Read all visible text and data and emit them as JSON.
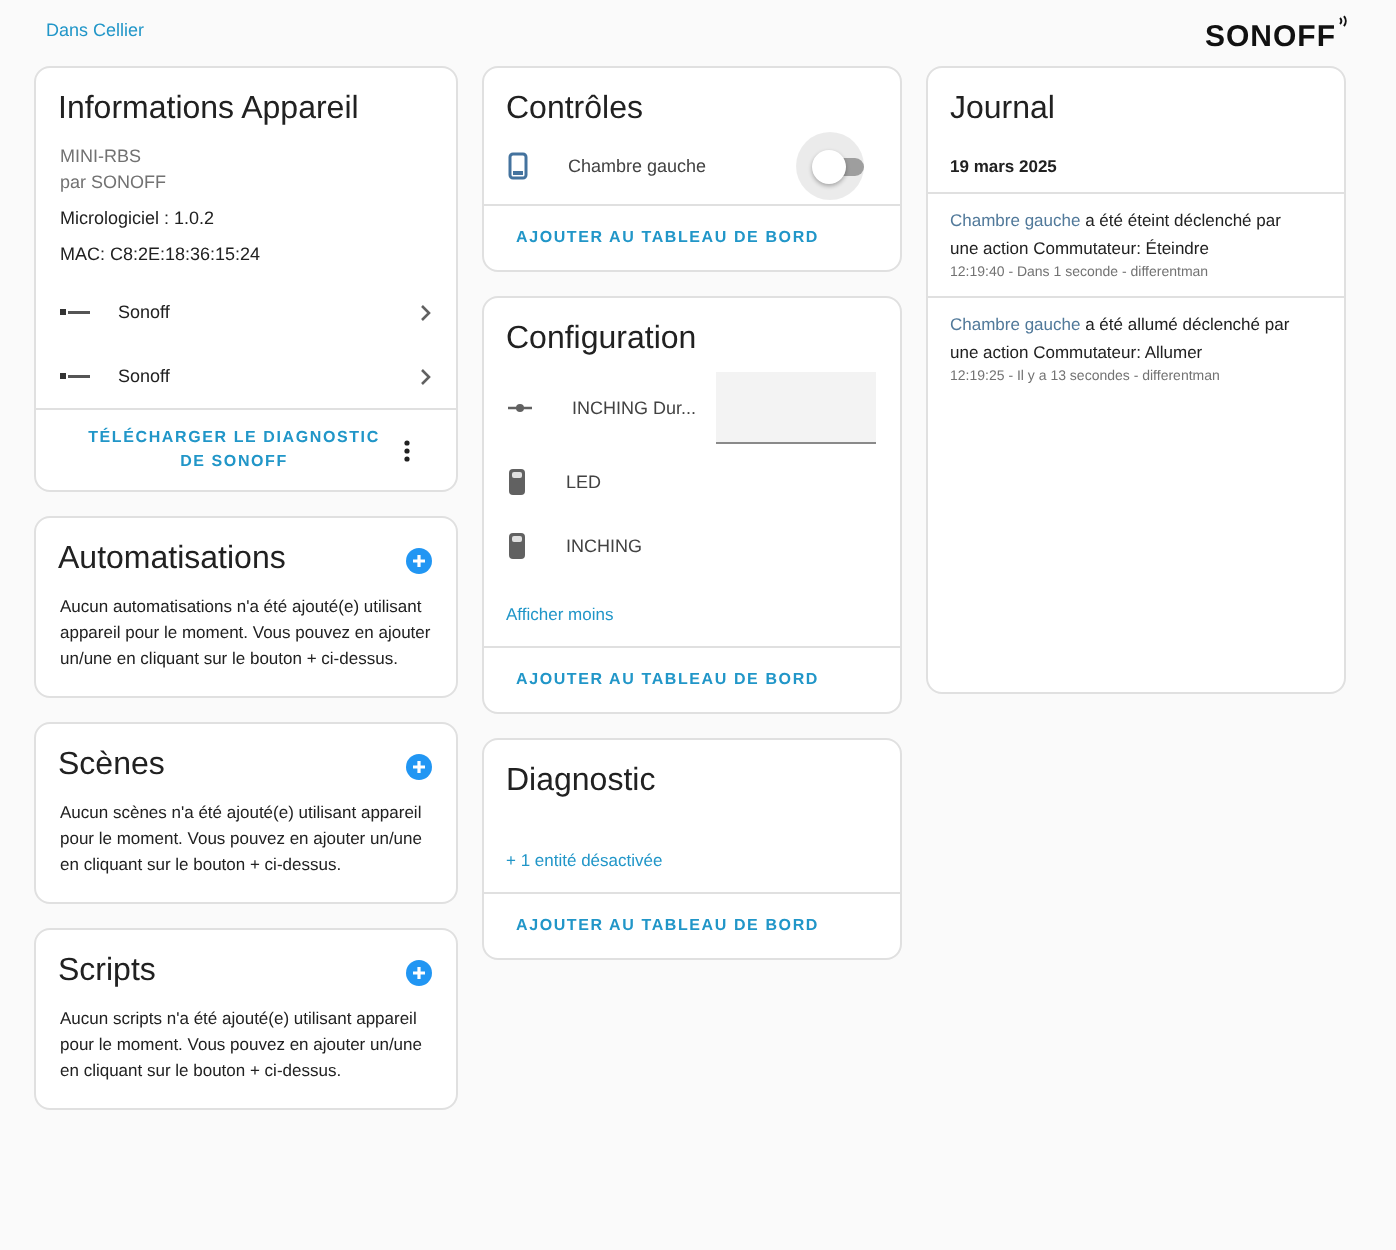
{
  "breadcrumb": "Dans Cellier",
  "logo": "SONOFF",
  "device_info": {
    "title": "Informations Appareil",
    "model": "MINI-RBS",
    "manufacturer": "par SONOFF",
    "firmware": "Micrologiciel : 1.0.2",
    "mac": "MAC: C8:2E:18:36:15:24",
    "integrations": [
      {
        "label": "Sonoff"
      },
      {
        "label": "Sonoff"
      }
    ],
    "action": "TÉLÉCHARGER LE DIAGNOSTIC DE SONOFF"
  },
  "related": [
    {
      "title": "Automatisations",
      "text": "Aucun automatisations n'a été ajouté(e) utilisant appareil pour le moment. Vous pouvez en ajouter un/une en cliquant sur le bouton + ci-dessus."
    },
    {
      "title": "Scènes",
      "text": "Aucun scènes n'a été ajouté(e) utilisant appareil pour le moment. Vous pouvez en ajouter un/une en cliquant sur le bouton + ci-dessus."
    },
    {
      "title": "Scripts",
      "text": "Aucun scripts n'a été ajouté(e) utilisant appareil pour le moment. Vous pouvez en ajouter un/une en cliquant sur le bouton + ci-dessus."
    }
  ],
  "controls": {
    "title": "Contrôles",
    "entities": [
      {
        "kind": "toggle",
        "name": "Chambre gauche",
        "on": false
      }
    ],
    "action": "AJOUTER AU TABLEAU DE BORD"
  },
  "configuration": {
    "title": "Configuration",
    "entities": [
      {
        "kind": "number",
        "name": "INCHING Dur..."
      },
      {
        "kind": "entity",
        "name": "LED"
      },
      {
        "kind": "entity",
        "name": "INCHING"
      }
    ],
    "link": "Afficher moins",
    "action": "AJOUTER AU TABLEAU DE BORD"
  },
  "diagnostic": {
    "title": "Diagnostic",
    "link": "+ 1 entité désactivée",
    "action": "AJOUTER AU TABLEAU DE BORD"
  },
  "journal": {
    "title": "Journal",
    "date": "19 mars 2025",
    "entries": [
      {
        "entity": "Chambre gauche",
        "message": "a été éteint déclenché par une action Commutateur: Éteindre",
        "meta": "12:19:40 - Dans 1 seconde - differentman"
      },
      {
        "entity": "Chambre gauche",
        "message": "a été allumé déclenché par une action Commutateur: Allumer",
        "meta": "12:19:25 - Il y a 13 secondes - differentman"
      }
    ]
  }
}
